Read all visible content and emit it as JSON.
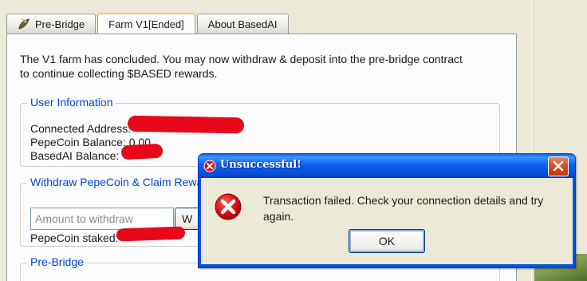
{
  "tabs": [
    {
      "label": "Pre-Bridge",
      "icon": "frog-leaf-icon"
    },
    {
      "label": "Farm V1[Ended]"
    },
    {
      "label": "About BasedAI"
    }
  ],
  "intro": {
    "line1": "The V1 farm has concluded. You may now withdraw & deposit into the pre-bridge contract",
    "line2": "to continue collecting $BASED rewards."
  },
  "user_info": {
    "title": "User Information",
    "connected_label": "Connected Address:",
    "pepecoin_label": "PepeCoin Balance: 0.00",
    "basedai_label": "BasedAI Balance: "
  },
  "withdraw": {
    "title": "Withdraw PepeCoin & Claim Rewards",
    "amount_placeholder": "Amount to withdraw",
    "withdraw_button": "W",
    "staked_label": "PepeCoin staked: "
  },
  "prebridge": {
    "title": "Pre-Bridge"
  },
  "dialog": {
    "title": "Unsuccessful!",
    "message_line1": "Transaction failed. Check your connection details and try",
    "message_line2": "again.",
    "ok_label": "OK"
  },
  "colors": {
    "accent_blue": "#0046d5",
    "titlebar_blue": "#0054e3",
    "error_red": "#e8081a",
    "tab_highlight": "#ffc83c"
  }
}
